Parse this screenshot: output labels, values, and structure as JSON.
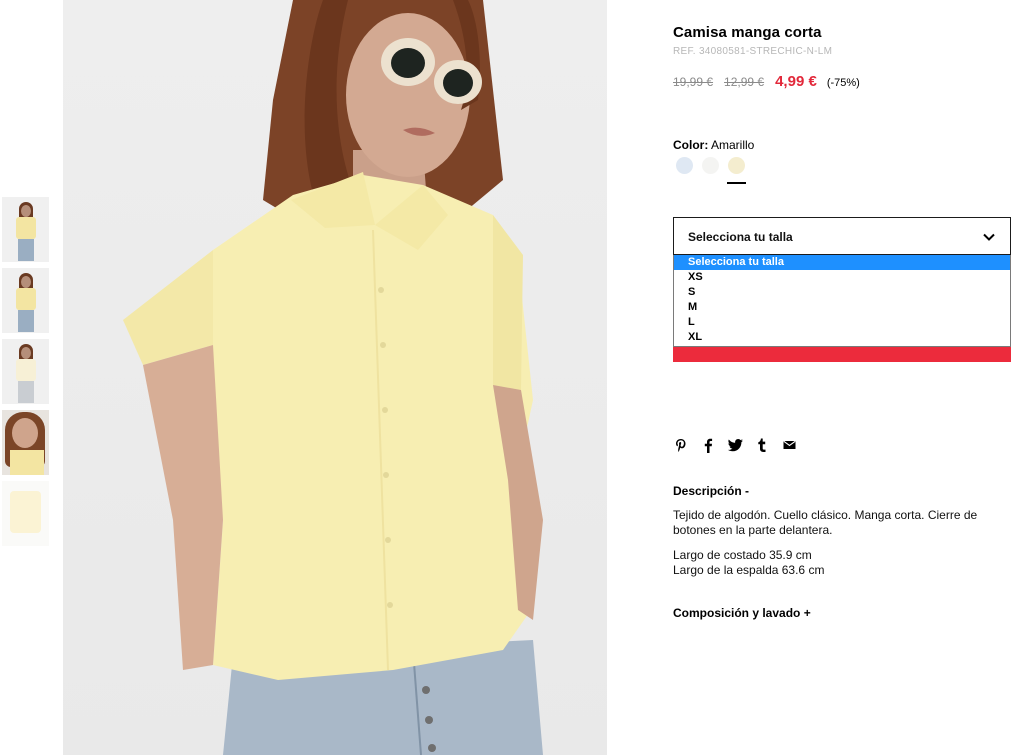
{
  "product": {
    "title": "Camisa manga corta",
    "reference": "REF. 34080581-STRECHIC-N-LM",
    "old_price_1": "19,99 €",
    "old_price_2": "12,99 €",
    "current_price": "4,99 €",
    "discount": "(-75%)"
  },
  "color": {
    "label": "Color:",
    "selected_name": "Amarillo",
    "swatches": [
      {
        "name": "light-blue",
        "hex": "#dfe8f3"
      },
      {
        "name": "white",
        "hex": "#f4f4f2"
      },
      {
        "name": "yellow",
        "hex": "#f4edcf"
      }
    ]
  },
  "size": {
    "selected_label": "Selecciona tu talla",
    "options": [
      "Selecciona tu talla",
      "XS",
      "S",
      "M",
      "L",
      "XL"
    ],
    "highlight_color": "#1e90ff"
  },
  "add_button": {
    "color": "#ec2b3c"
  },
  "social": [
    "pinterest-icon",
    "facebook-icon",
    "twitter-icon",
    "tumblr-icon",
    "email-icon"
  ],
  "description": {
    "heading": "Descripción -",
    "text": "Tejido de algodón. Cuello clásico. Manga corta. Cierre de botones en la parte delantera.",
    "side_length": "Largo de costado 35.9 cm",
    "back_length": "Largo de la espalda 63.6 cm"
  },
  "composition": {
    "heading": "Composición y lavado +"
  },
  "colors": {
    "sale_red": "#e2283a",
    "shirt_yellow": "#f7eeb2"
  }
}
